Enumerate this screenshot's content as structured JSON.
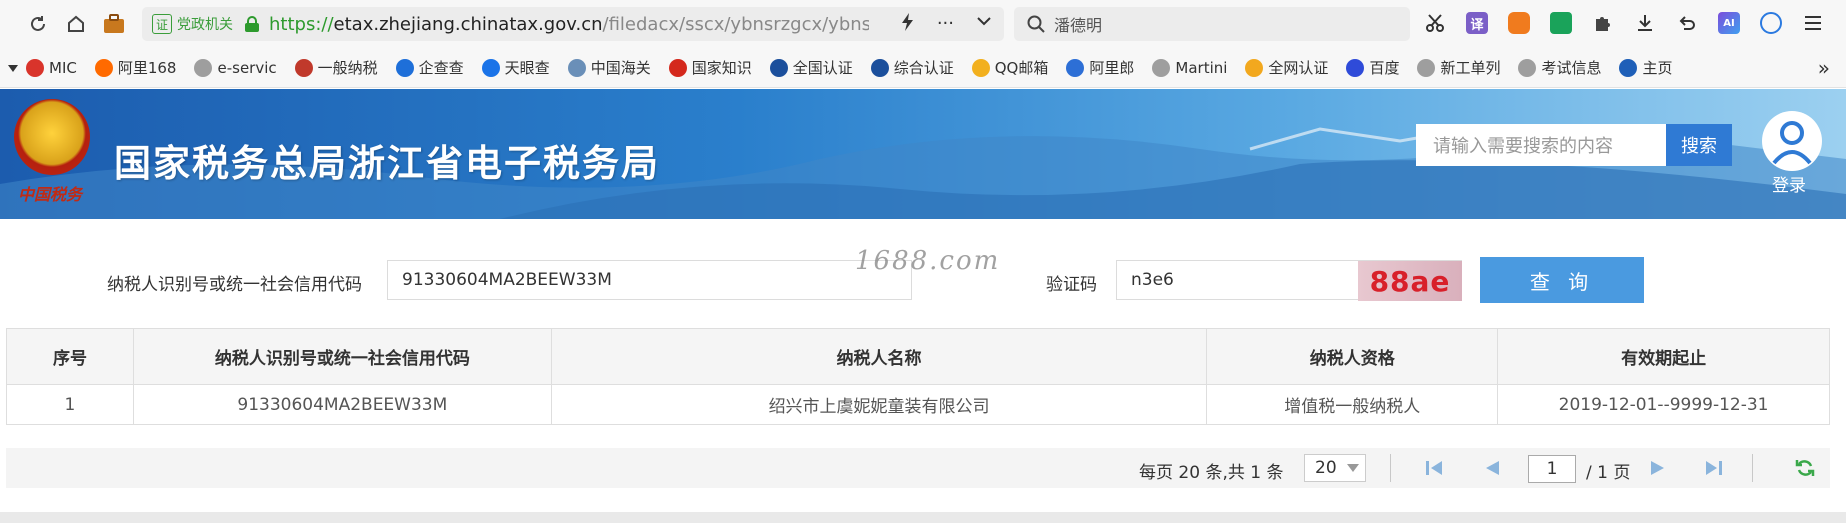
{
  "browser": {
    "url_scheme": "https://",
    "url_host": "etax.zhejiang.chinatax.gov.cn",
    "url_path": "/filedacx/sscx/ybnsrzgcx/ybnsrzgc",
    "cert_glyph": "证",
    "cert_label": "党政机关",
    "search_text": "潘德明",
    "more_glyph": "···",
    "ext_translate": "译",
    "ext_ai": "AI"
  },
  "bookmarks": [
    {
      "label": "MIC",
      "color": "#d9342b"
    },
    {
      "label": "阿里168",
      "color": "#ff6a00"
    },
    {
      "label": "e-servic",
      "color": "#9e9e9e"
    },
    {
      "label": "一般纳税",
      "color": "#c0392b"
    },
    {
      "label": "企查查",
      "color": "#1e6fd9"
    },
    {
      "label": "天眼查",
      "color": "#1a73e8"
    },
    {
      "label": "中国海关",
      "color": "#6a8fb8"
    },
    {
      "label": "国家知识",
      "color": "#d4281c"
    },
    {
      "label": "全国认证",
      "color": "#1b4f9c"
    },
    {
      "label": "综合认证",
      "color": "#1b4f9c"
    },
    {
      "label": "QQ邮箱",
      "color": "#f2b01e"
    },
    {
      "label": "阿里郎",
      "color": "#2d6fd6"
    },
    {
      "label": "Martini",
      "color": "#9e9e9e"
    },
    {
      "label": "全网认证",
      "color": "#f2a81e"
    },
    {
      "label": "百度",
      "color": "#2f4bd9"
    },
    {
      "label": "新工单列",
      "color": "#9e9e9e"
    },
    {
      "label": "考试信息",
      "color": "#9e9e9e"
    },
    {
      "label": "主页",
      "color": "#1e5fb8"
    }
  ],
  "banner": {
    "title": "国家税务总局浙江省电子税务局",
    "emblem_text": "中国税务",
    "search_placeholder": "请输入需要搜索的内容",
    "search_button": "搜索",
    "login_label": "登录"
  },
  "form": {
    "taxpayer_id_label": "纳税人识别号或统一社会信用代码",
    "taxpayer_id_value": "91330604MA2BEEW33M",
    "captcha_label": "验证码",
    "captcha_value": "n3e6",
    "captcha_image_text": "88ae",
    "query_button": "查 询",
    "watermark": "1688.com"
  },
  "table": {
    "headers": [
      "序号",
      "纳税人识别号或统一社会信用代码",
      "纳税人名称",
      "纳税人资格",
      "有效期起止"
    ],
    "rows": [
      [
        "1",
        "91330604MA2BEEW33M",
        "绍兴市上虞妮妮童装有限公司",
        "增值税一般纳税人",
        "2019-12-01--9999-12-31"
      ]
    ]
  },
  "pagination": {
    "summary": "每页 20 条,共 1 条",
    "page_size": "20",
    "current_page": "1",
    "total_pages": "/ 1 页"
  },
  "colors": {
    "accent_blue": "#4a9ae0",
    "site_search_blue": "#2f7ad4",
    "secure_green": "#2d9a2d"
  }
}
